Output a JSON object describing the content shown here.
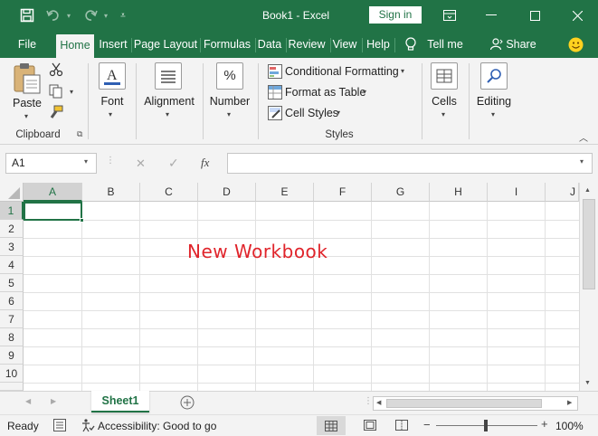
{
  "titlebar": {
    "title": "Book1  -  Excel",
    "signin_label": "Sign in",
    "save_icon": "save-icon",
    "undo_icon": "undo-icon",
    "redo_icon": "redo-icon"
  },
  "tabs": [
    {
      "label": "File"
    },
    {
      "label": "Home"
    },
    {
      "label": "Insert"
    },
    {
      "label": "Page Layout"
    },
    {
      "label": "Formulas"
    },
    {
      "label": "Data"
    },
    {
      "label": "Review"
    },
    {
      "label": "View"
    },
    {
      "label": "Help"
    }
  ],
  "tell_me": "Tell me",
  "share": "Share",
  "ribbon": {
    "clipboard": {
      "paste": "Paste",
      "group": "Clipboard"
    },
    "font": "Font",
    "alignment": "Alignment",
    "number": "Number",
    "number_icon": "%",
    "styles": {
      "conditional": "Conditional Formatting",
      "format_table": "Format as Table",
      "cell_styles": "Cell Styles",
      "group": "Styles"
    },
    "cells": "Cells",
    "editing": "Editing"
  },
  "formula_bar": {
    "name_box": "A1",
    "fx": "fx",
    "value": ""
  },
  "grid": {
    "columns": [
      "A",
      "B",
      "C",
      "D",
      "E",
      "F",
      "G",
      "H",
      "I",
      "J"
    ],
    "rows": [
      "1",
      "2",
      "3",
      "4",
      "5",
      "6",
      "7",
      "8",
      "9",
      "10"
    ],
    "annotation": "New Workbook"
  },
  "sheets": [
    {
      "label": "Sheet1"
    }
  ],
  "status": {
    "ready": "Ready",
    "accessibility": "Accessibility: Good to go",
    "zoom": "100%"
  },
  "colors": {
    "accent": "#217346",
    "annotation": "#e0242b"
  }
}
